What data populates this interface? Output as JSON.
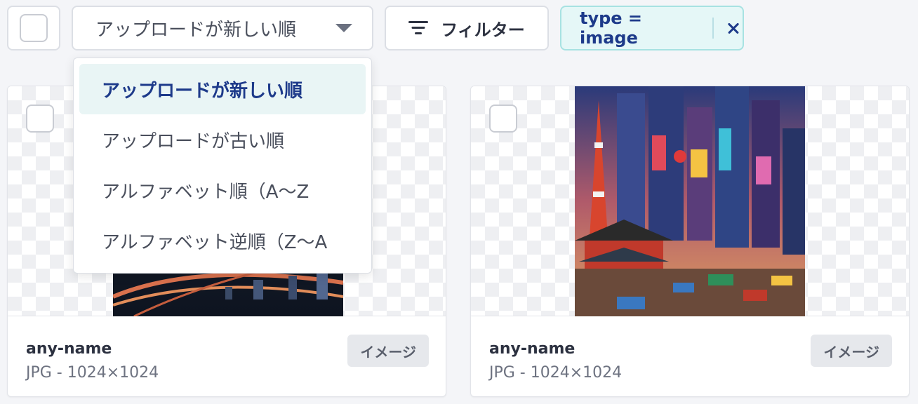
{
  "toolbar": {
    "sort_selected": "アップロードが新しい順",
    "filter_label": "フィルター",
    "active_filter": "type = image"
  },
  "sort_menu": {
    "options": [
      "アップロードが新しい順",
      "アップロードが古い順",
      "アルファベット順（A〜Z",
      "アルファベット逆順（Z〜A"
    ],
    "selected_index": 0
  },
  "cards": [
    {
      "name": "any-name",
      "meta": "JPG - 1024×1024",
      "badge": "イメージ"
    },
    {
      "name": "any-name",
      "meta": "JPG - 1024×1024",
      "badge": "イメージ"
    }
  ],
  "colors": {
    "accent": "#1d3a8a",
    "chip_bg": "#e5f7f7",
    "chip_border": "#a7e2e2",
    "active_item_bg": "#e9f5f5",
    "page_bg": "#f4f5f8"
  },
  "icons": {
    "sort_caret": "caret-down-icon",
    "filter": "filter-lines-icon",
    "remove_filter": "close-icon"
  }
}
